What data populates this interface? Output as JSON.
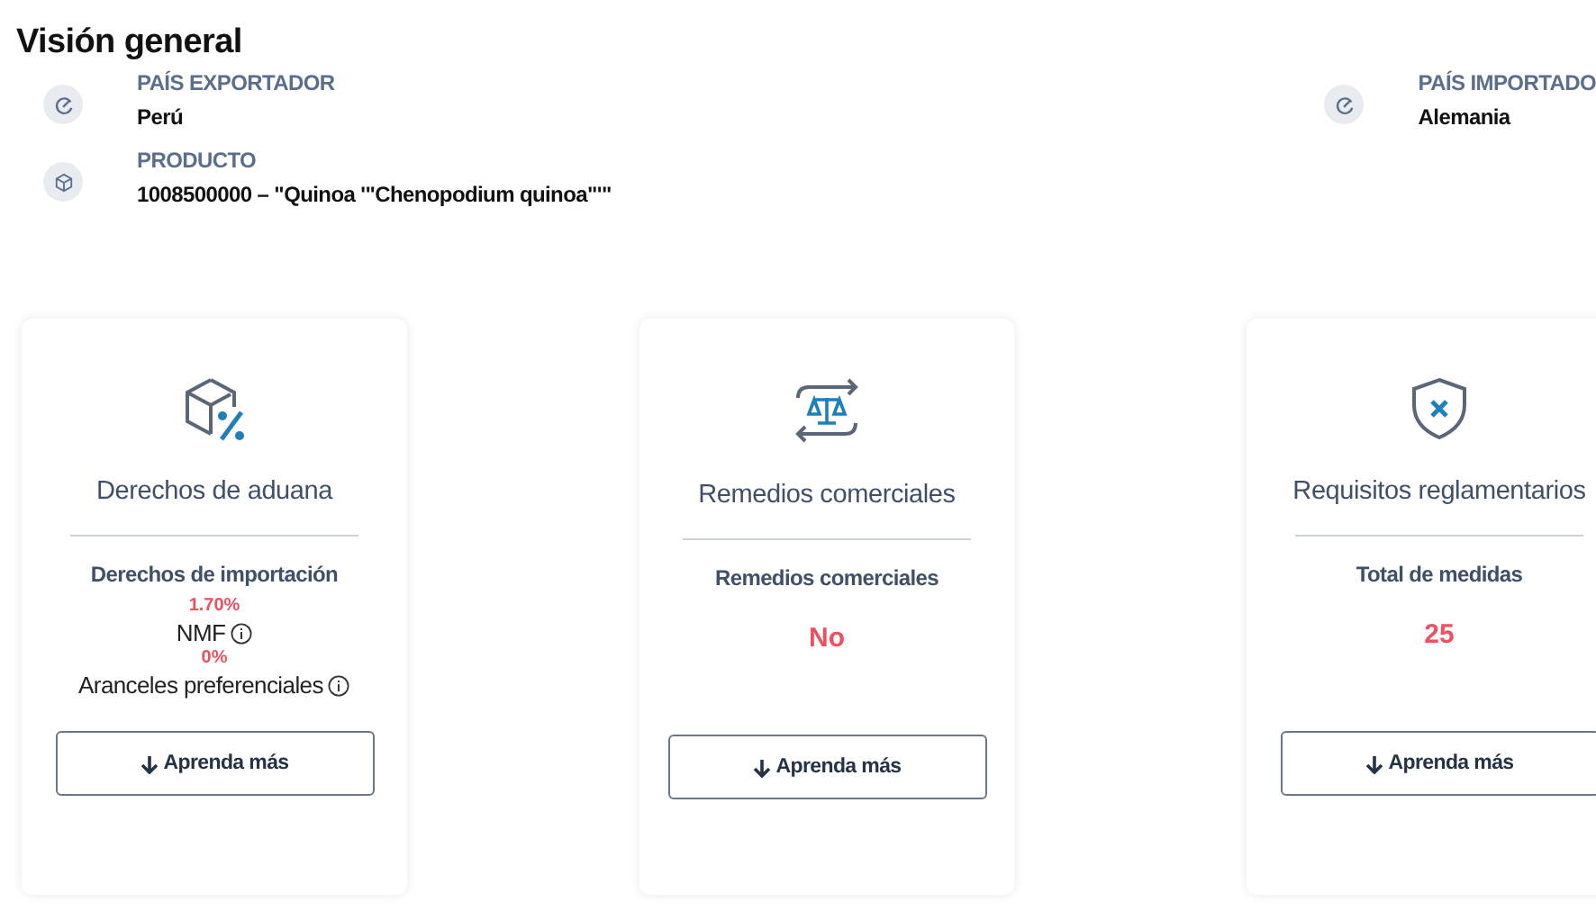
{
  "title": "Visión general",
  "info_left": [
    {
      "kind": "country",
      "label": "PAÍS EXPORTADOR",
      "value": "Perú"
    },
    {
      "kind": "product",
      "label": "PRODUCTO",
      "value": "1008500000 – \"Quinoa '\"Chenopodium quinoa\"'\""
    }
  ],
  "info_right": [
    {
      "kind": "country",
      "label": "PAÍS IMPORTADO",
      "value": "Alemania"
    }
  ],
  "cards": [
    {
      "kind": "duties",
      "title": "Derechos de aduana",
      "lines": [
        {
          "kind": "label",
          "text": "Derechos de importación"
        },
        {
          "kind": "value",
          "text": "1.70%"
        },
        {
          "kind": "note",
          "text": "NMF",
          "info": true
        },
        {
          "kind": "value",
          "text": "0%"
        },
        {
          "kind": "note",
          "text": "Aranceles preferenciales",
          "info": true
        }
      ],
      "button": "Aprenda más"
    },
    {
      "kind": "remedies",
      "title": "Remedios comerciales",
      "lines": [
        {
          "kind": "label",
          "text": "Remedios comerciales"
        },
        {
          "kind": "big",
          "text": "No"
        }
      ],
      "button": "Aprenda más"
    },
    {
      "kind": "requirements",
      "title": "Requisitos reglamentarios",
      "lines": [
        {
          "kind": "label",
          "text": "Total de medidas"
        },
        {
          "kind": "big",
          "text": "25"
        }
      ],
      "button": "Aprenda más"
    }
  ]
}
